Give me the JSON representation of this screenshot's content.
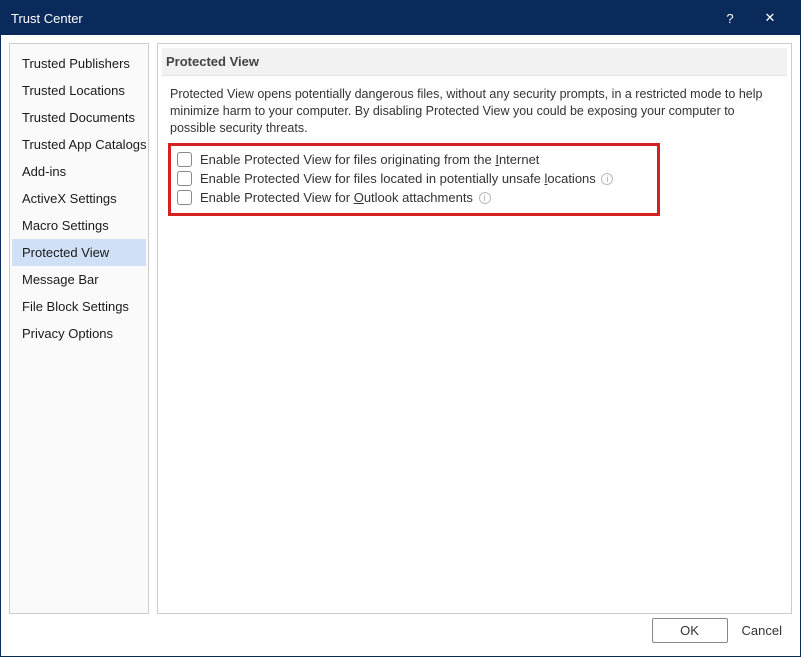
{
  "window": {
    "title": "Trust Center",
    "help_label": "?",
    "close_label": "✕"
  },
  "sidebar": {
    "items": [
      {
        "label": "Trusted Publishers"
      },
      {
        "label": "Trusted Locations"
      },
      {
        "label": "Trusted Documents"
      },
      {
        "label": "Trusted App Catalogs"
      },
      {
        "label": "Add-ins"
      },
      {
        "label": "ActiveX Settings"
      },
      {
        "label": "Macro Settings"
      },
      {
        "label": "Protected View"
      },
      {
        "label": "Message Bar"
      },
      {
        "label": "File Block Settings"
      },
      {
        "label": "Privacy Options"
      }
    ],
    "selected_index": 7
  },
  "main": {
    "header": "Protected View",
    "description": "Protected View opens potentially dangerous files, without any security prompts, in a restricted mode to help minimize harm to your computer. By disabling Protected View you could be exposing your computer to possible security threats.",
    "options": [
      {
        "checked": false,
        "label_prefix": "Enable Protected View for files originating from the ",
        "accesskey": "I",
        "label_suffix": "nternet",
        "has_info": false
      },
      {
        "checked": false,
        "label_prefix": "Enable Protected View for files located in potentially unsafe ",
        "accesskey": "l",
        "label_suffix": "ocations",
        "has_info": true
      },
      {
        "checked": false,
        "label_prefix": "Enable Protected View for ",
        "accesskey": "O",
        "label_suffix": "utlook attachments",
        "has_info": true
      }
    ]
  },
  "footer": {
    "ok_label": "OK",
    "cancel_label": "Cancel"
  },
  "colors": {
    "titlebar_bg": "#0a2a5c",
    "highlight_border": "#d62121",
    "selection_bg": "#cfe0f7"
  }
}
